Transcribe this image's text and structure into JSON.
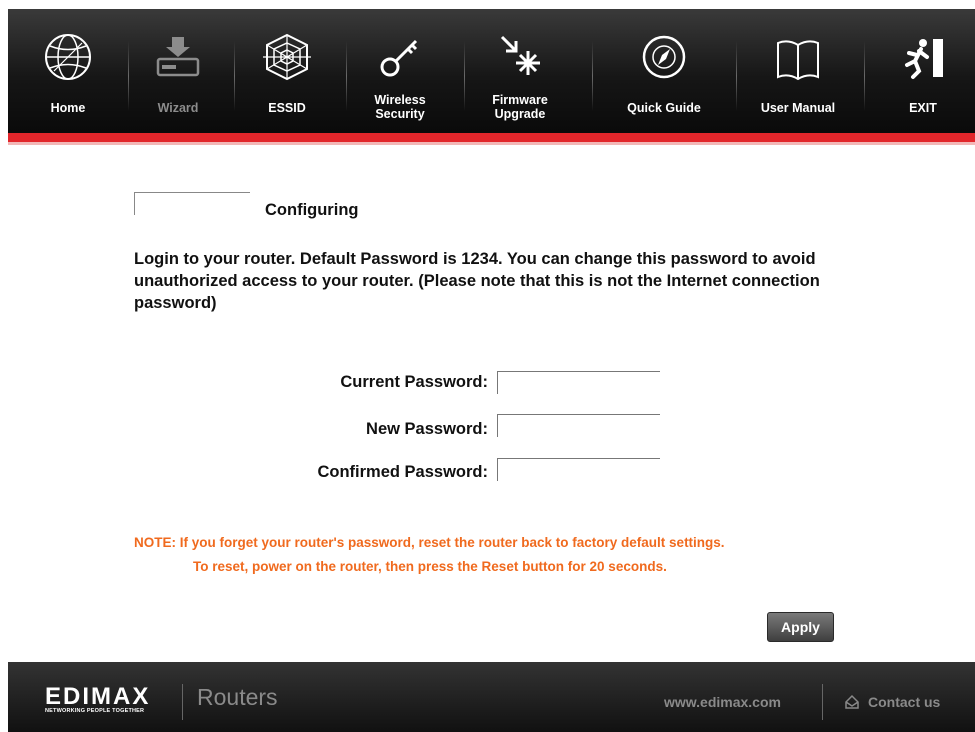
{
  "nav": {
    "items": [
      {
        "label": "Home",
        "icon": "globe-icon"
      },
      {
        "label": "Wizard",
        "icon": "download-drive-icon"
      },
      {
        "label": "ESSID",
        "icon": "web-icon"
      },
      {
        "label_line1": "Wireless",
        "label_line2": "Security",
        "icon": "key-icon"
      },
      {
        "label_line1": "Firmware",
        "label_line2": "Upgrade",
        "icon": "arrow-burst-icon"
      },
      {
        "label": "Quick Guide",
        "icon": "compass-icon"
      },
      {
        "label": "User Manual",
        "icon": "book-icon"
      },
      {
        "label": "EXIT",
        "icon": "running-man-icon"
      }
    ],
    "accent": "#e2262b"
  },
  "main": {
    "title": "Configuring",
    "intro": "Login to your router.  Default Password is 1234. You can change this password to avoid unauthorized access to your router. (Please note that this is not the Internet connection password)",
    "fields": {
      "current_label": "Current Password:",
      "current_value": "",
      "new_label": "New Password:",
      "new_value": "",
      "confirm_label": "Confirmed Password:",
      "confirm_value": ""
    },
    "note_line1": "NOTE: If you forget your router's password, reset the router  back to factory default settings.",
    "note_line2": "To reset, power on the router, then press  the Reset button for 20 seconds.",
    "note_color": "#f06a1e",
    "apply_label": "Apply"
  },
  "footer": {
    "brand": "EDIMAX",
    "tagline": "NETWORKING PEOPLE TOGETHER",
    "product": "Routers",
    "website": "www.edimax.com",
    "contact": "Contact us"
  }
}
